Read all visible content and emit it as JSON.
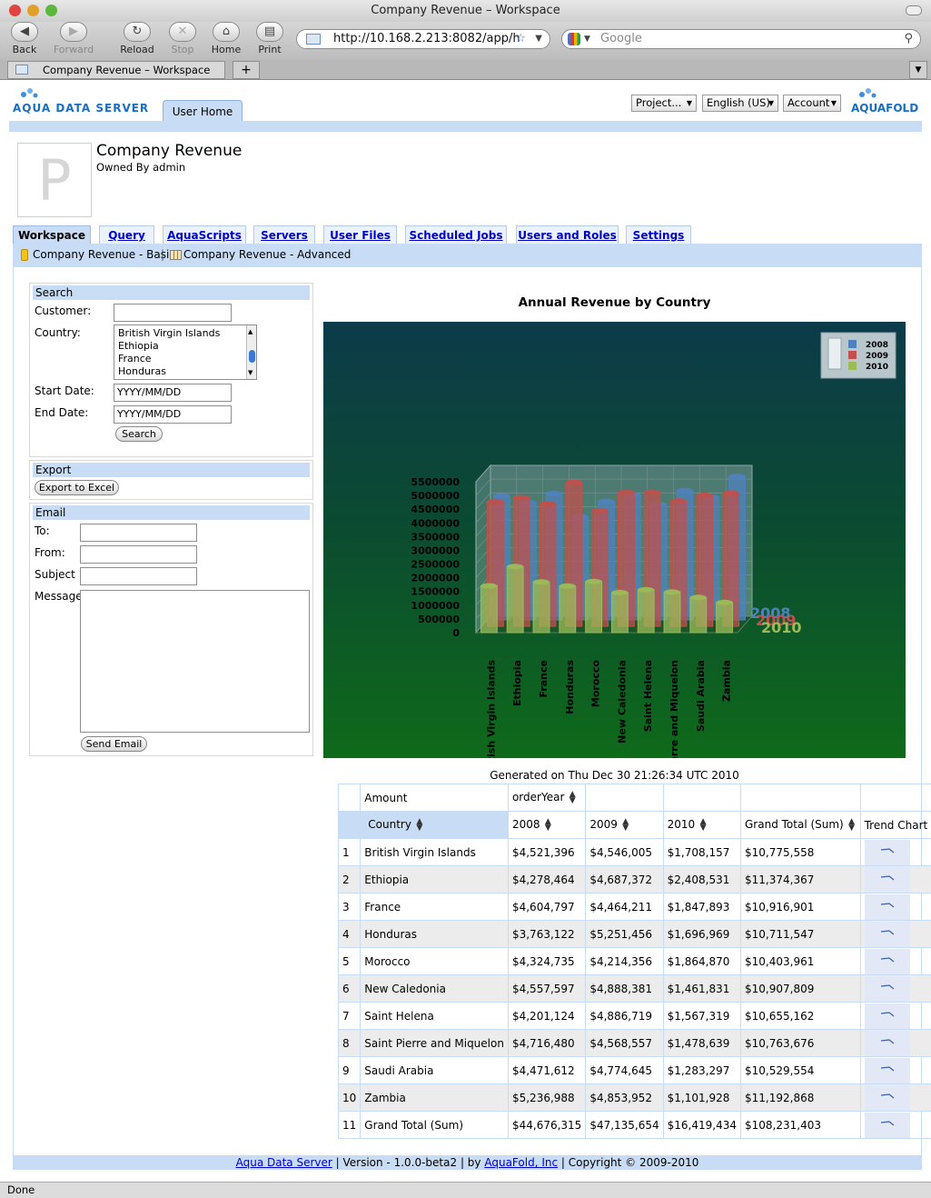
{
  "browser": {
    "window_title": "Company Revenue – Workspace",
    "nav": {
      "back": "Back",
      "forward": "Forward",
      "reload": "Reload",
      "stop": "Stop",
      "home": "Home",
      "print": "Print"
    },
    "url": "http://10.168.2.213:8082/app/h",
    "search_placeholder": "Google",
    "tab_title": "Company Revenue – Workspace",
    "new_tab": "+",
    "status": "Done"
  },
  "header": {
    "logo_left": "AQUA DATA SERVER",
    "user_home_tab": "User Home",
    "project_menu": "Project...",
    "language_menu": "English (US)",
    "account_menu": "Account",
    "logo_right": "AQUAFOLD"
  },
  "project": {
    "avatar_letter": "P",
    "title": "Company Revenue",
    "owner": "Owned By admin"
  },
  "tabs": [
    "Workspace",
    "Query",
    "AquaScripts",
    "Servers",
    "User Files",
    "Scheduled Jobs",
    "Users and Roles",
    "Settings"
  ],
  "subnav": {
    "basic": "Company Revenue - Basic",
    "sep": "|",
    "advanced": "Company Revenue - Advanced"
  },
  "search": {
    "header": "Search",
    "customer_label": "Customer:",
    "customer_value": "",
    "country_label": "Country:",
    "countries": [
      "British Virgin Islands",
      "Ethiopia",
      "France",
      "Honduras"
    ],
    "start_label": "Start Date:",
    "start_value": "YYYY/MM/DD",
    "end_label": "End Date:",
    "end_value": "YYYY/MM/DD",
    "button": "Search"
  },
  "export": {
    "header": "Export",
    "button": "Export to Excel"
  },
  "email": {
    "header": "Email",
    "to": "To:",
    "from": "From:",
    "subject": "Subject",
    "message": "Message",
    "button": "Send Email"
  },
  "chart_data": {
    "type": "bar",
    "title": "Annual Revenue by Country",
    "categories": [
      "British Virgin Islands",
      "Ethiopia",
      "France",
      "Honduras",
      "Morocco",
      "New Caledonia",
      "Saint Helena",
      "Saint Pierre and Miquelon",
      "Saudi Arabia",
      "Zambia"
    ],
    "series": [
      {
        "name": "2008",
        "color": "#4f81bd",
        "values": [
          4521396,
          4278464,
          4604797,
          3763122,
          4324735,
          4557597,
          4201124,
          4716480,
          4471612,
          5236988
        ]
      },
      {
        "name": "2009",
        "color": "#c0504d",
        "values": [
          4546005,
          4687372,
          4464211,
          5251456,
          4214356,
          4888381,
          4886719,
          4568557,
          4774645,
          4853952
        ]
      },
      {
        "name": "2010",
        "color": "#9bbb59",
        "values": [
          1708157,
          2408531,
          1847893,
          1696969,
          1864870,
          1461831,
          1567319,
          1478639,
          1283297,
          1101928
        ]
      }
    ],
    "yticks": [
      "0",
      "500000",
      "1000000",
      "1500000",
      "2000000",
      "2500000",
      "3000000",
      "3500000",
      "4000000",
      "4500000",
      "5000000",
      "5500000"
    ],
    "ylim": [
      0,
      5500000
    ],
    "legend": "top-right",
    "grid": true,
    "generated": "Generated on Thu Dec 30 21:26:34 UTC 2010"
  },
  "pivot": {
    "measure": "Amount",
    "col_field": "orderYear",
    "row_field": "Country",
    "col_headers": [
      "2008",
      "2009",
      "2010",
      "Grand Total (Sum)",
      "Trend Chart"
    ],
    "rows": [
      {
        "n": "1",
        "country": "British Virgin Islands",
        "y2008": "$4,521,396",
        "y2009": "$4,546,005",
        "y2010": "$1,708,157",
        "total": "$10,775,558"
      },
      {
        "n": "2",
        "country": "Ethiopia",
        "y2008": "$4,278,464",
        "y2009": "$4,687,372",
        "y2010": "$2,408,531",
        "total": "$11,374,367"
      },
      {
        "n": "3",
        "country": "France",
        "y2008": "$4,604,797",
        "y2009": "$4,464,211",
        "y2010": "$1,847,893",
        "total": "$10,916,901"
      },
      {
        "n": "4",
        "country": "Honduras",
        "y2008": "$3,763,122",
        "y2009": "$5,251,456",
        "y2010": "$1,696,969",
        "total": "$10,711,547"
      },
      {
        "n": "5",
        "country": "Morocco",
        "y2008": "$4,324,735",
        "y2009": "$4,214,356",
        "y2010": "$1,864,870",
        "total": "$10,403,961"
      },
      {
        "n": "6",
        "country": "New Caledonia",
        "y2008": "$4,557,597",
        "y2009": "$4,888,381",
        "y2010": "$1,461,831",
        "total": "$10,907,809"
      },
      {
        "n": "7",
        "country": "Saint Helena",
        "y2008": "$4,201,124",
        "y2009": "$4,886,719",
        "y2010": "$1,567,319",
        "total": "$10,655,162"
      },
      {
        "n": "8",
        "country": "Saint Pierre and Miquelon",
        "y2008": "$4,716,480",
        "y2009": "$4,568,557",
        "y2010": "$1,478,639",
        "total": "$10,763,676"
      },
      {
        "n": "9",
        "country": "Saudi Arabia",
        "y2008": "$4,471,612",
        "y2009": "$4,774,645",
        "y2010": "$1,283,297",
        "total": "$10,529,554"
      },
      {
        "n": "10",
        "country": "Zambia",
        "y2008": "$5,236,988",
        "y2009": "$4,853,952",
        "y2010": "$1,101,928",
        "total": "$11,192,868"
      },
      {
        "n": "11",
        "country": "Grand Total (Sum)",
        "y2008": "$44,676,315",
        "y2009": "$47,135,654",
        "y2010": "$16,419,434",
        "total": "$108,231,403"
      }
    ]
  },
  "footer": {
    "product_link": "Aqua Data Server",
    "version": " | Version - 1.0.0-beta2 | by ",
    "company_link": "AquaFold, Inc",
    "copyright": " | Copyright © 2009-2010"
  },
  "colors": {
    "accent": "#c9dcf5",
    "link": "#0000cc"
  }
}
